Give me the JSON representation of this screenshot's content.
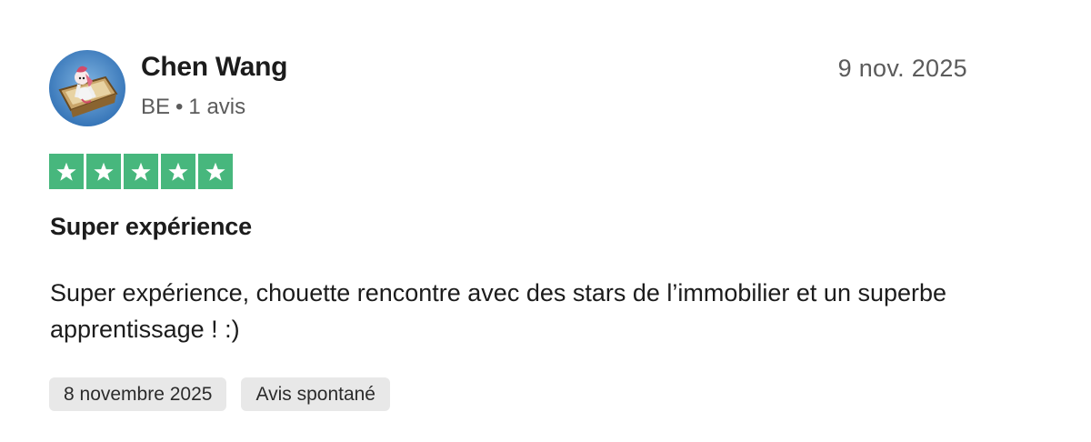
{
  "review": {
    "reviewer": {
      "name": "Chen Wang",
      "country": "BE",
      "separator": "•",
      "review_count": "1 avis",
      "avatar_icon": "user-avatar-cartoon"
    },
    "date": "9 nov. 2025",
    "rating": {
      "stars": 5,
      "max": 5,
      "star_color": "#47b77d",
      "icon": "star-icon"
    },
    "title": "Super expérience",
    "body": "Super expérience, chouette rencontre avec des stars de l’immobilier et un superbe apprentissage ! :)",
    "tags": [
      {
        "label": "8 novembre 2025"
      },
      {
        "label": "Avis spontané"
      }
    ]
  }
}
